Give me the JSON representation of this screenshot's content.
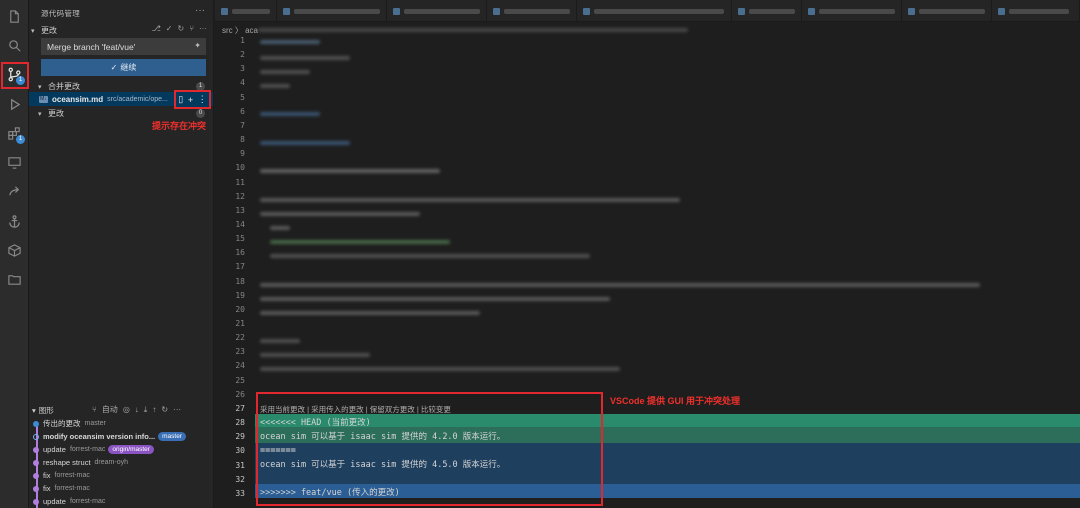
{
  "activity_bar": {
    "items": [
      {
        "name": "explorer-icon"
      },
      {
        "name": "search-icon"
      },
      {
        "name": "source-control-icon",
        "badge": "1"
      },
      {
        "name": "run-debug-icon"
      },
      {
        "name": "extensions-icon",
        "badge": "1"
      },
      {
        "name": "remote-explorer-icon"
      },
      {
        "name": "share-icon"
      },
      {
        "name": "anchor-icon"
      },
      {
        "name": "package-icon"
      },
      {
        "name": "folder-icon"
      }
    ]
  },
  "sidebar": {
    "title": "源代码管理",
    "changes_section": "更改",
    "commit_message": "Merge branch 'feat/vue'",
    "commit_button": "继续",
    "merge_changes_section": "合并更改",
    "merge_count": "1",
    "changes_count": "0",
    "file": {
      "name": "oceansim.md",
      "path": "src/academic/ope..."
    },
    "conflict_annotation": "提示存在冲突",
    "changes_subsection": "更改",
    "graph": {
      "title": "图形",
      "auto_label": "自动",
      "rows": [
        {
          "message": "传出的更改",
          "author": "master",
          "tag": ""
        },
        {
          "message": "modify oceansim version info...",
          "author": "",
          "tag": "master"
        },
        {
          "message": "update",
          "author": "forrest-mac",
          "tag": "origin/master"
        },
        {
          "message": "reshape struct",
          "author": "dream-oyh",
          "tag": ""
        },
        {
          "message": "fix",
          "author": "forrest-mac",
          "tag": ""
        },
        {
          "message": "fix",
          "author": "forrest-mac",
          "tag": ""
        },
        {
          "message": "update",
          "author": "forrest-mac",
          "tag": ""
        }
      ]
    }
  },
  "editor": {
    "breadcrumb": "src 〉 aca",
    "line_numbers": [
      "1",
      "2",
      "3",
      "4",
      "5",
      "6",
      "7",
      "8",
      "9",
      "10",
      "11",
      "12",
      "13",
      "14",
      "15",
      "16",
      "17",
      "18",
      "19",
      "20",
      "21",
      "22",
      "23",
      "24",
      "25",
      "26",
      "27",
      "28",
      "29",
      "30",
      "31",
      "32",
      "33"
    ],
    "codelens": "采用当前更改 | 采用传入的更改 | 保留双方更改 | 比较变更",
    "conflict_lines": {
      "head_marker": "<<<<<<< HEAD (当前更改)",
      "current": "ocean sim 可以基于 isaac sim 提供的 4.2.0 版本运行。",
      "separator": "=======",
      "incoming": "ocean sim 可以基于 isaac sim 提供的 4.5.0 版本运行。",
      "incoming_marker": ">>>>>>> feat/vue (传入的更改)"
    },
    "annotation": "VSCode 提供 GUI 用于冲突处理"
  },
  "colors": {
    "current_change_bg": "#2d6e5a",
    "current_header_bg": "#2a8a6c",
    "incoming_change_bg": "#1f3f5e",
    "incoming_header_bg": "#2b5e94",
    "accent_red": "#e0282e"
  }
}
